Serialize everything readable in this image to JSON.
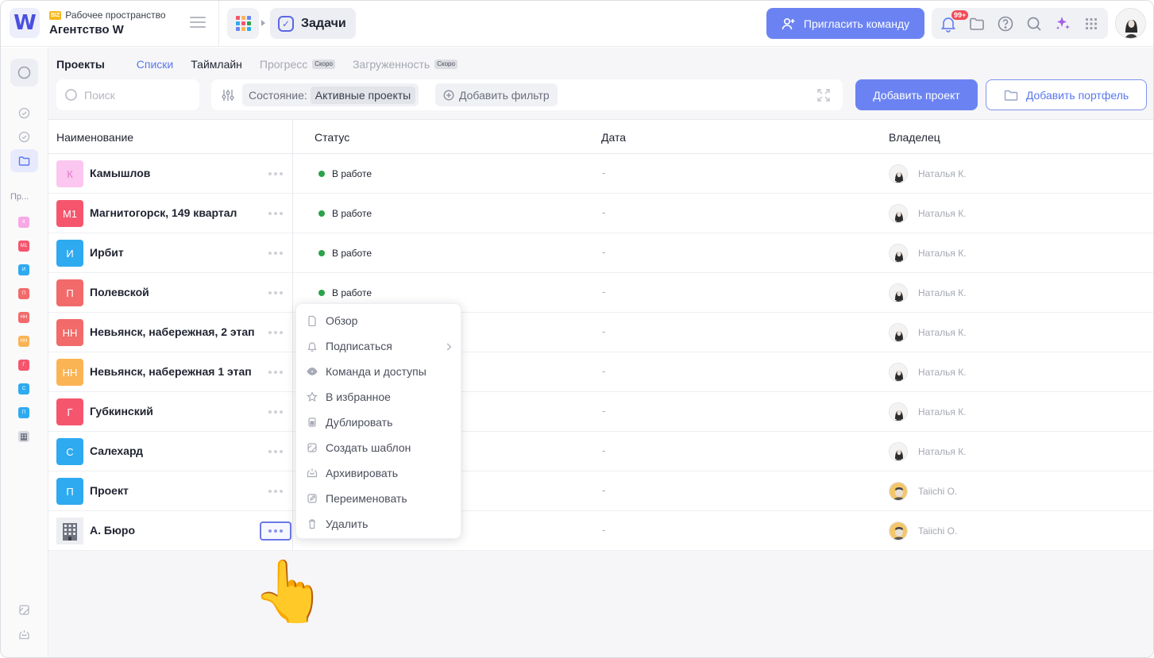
{
  "app": {
    "logo_letter": "W",
    "workspace_badge": "BIZ",
    "workspace_label": "Рабочее пространство",
    "workspace_name": "Агентство W",
    "section": "Задачи",
    "invite_label": "Пригласить команду",
    "notifications_count": "99+",
    "brand_color": "#6b83f2",
    "accent_color": "#5a78ee"
  },
  "rail": {
    "label": "Пр...",
    "chips": [
      {
        "text": "К",
        "color": "#f7a8e5"
      },
      {
        "text": "М1",
        "color": "#f5566e"
      },
      {
        "text": "И",
        "color": "#2eaaf0"
      },
      {
        "text": "П",
        "color": "#f26a6a"
      },
      {
        "text": "НН",
        "color": "#f26a6a"
      },
      {
        "text": "НН",
        "color": "#fbb454"
      },
      {
        "text": "Г",
        "color": "#f5566e"
      },
      {
        "text": "С",
        "color": "#2eaaf0"
      },
      {
        "text": "П",
        "color": "#2eaaf0"
      }
    ]
  },
  "tabs": {
    "title": "Проекты",
    "lists": "Списки",
    "timeline": "Таймлайн",
    "progress": "Прогресс",
    "workload": "Загруженность",
    "soon": "Скоро"
  },
  "toolbar": {
    "search_placeholder": "Поиск",
    "state_label": "Состояние:",
    "state_value": "Активные проекты",
    "add_filter": "Добавить фильтр",
    "add_project": "Добавить проект",
    "add_portfolio": "Добавить портфель"
  },
  "table": {
    "headers": {
      "name": "Наименование",
      "status": "Статус",
      "date": "Дата",
      "owner": "Владелец"
    },
    "rows": [
      {
        "chip": "К",
        "chip_color": "#fbc6ef",
        "chip_text_color": "#e07ccc",
        "name": "Камышлов",
        "status": "В работе",
        "date": "-",
        "owner": "Наталья К.",
        "avatar": "woman"
      },
      {
        "chip": "М1",
        "chip_color": "#f5566e",
        "chip_text_color": "#ffffff",
        "name": "Магнитогорск, 149 квартал",
        "status": "В работе",
        "date": "-",
        "owner": "Наталья К.",
        "avatar": "woman"
      },
      {
        "chip": "И",
        "chip_color": "#2eaaf0",
        "chip_text_color": "#ffffff",
        "name": "Ирбит",
        "status": "В работе",
        "date": "-",
        "owner": "Наталья К.",
        "avatar": "woman"
      },
      {
        "chip": "П",
        "chip_color": "#f26a6a",
        "chip_text_color": "#ffffff",
        "name": "Полевской",
        "status": "В работе",
        "date": "-",
        "owner": "Наталья К.",
        "avatar": "woman"
      },
      {
        "chip": "НН",
        "chip_color": "#f26a6a",
        "chip_text_color": "#ffffff",
        "name": "Невьянск, набережная, 2 этап",
        "status": "",
        "date": "-",
        "owner": "Наталья К.",
        "avatar": "woman"
      },
      {
        "chip": "НН",
        "chip_color": "#fbb454",
        "chip_text_color": "#ffffff",
        "name": "Невьянск, набережная 1 этап",
        "status": "",
        "date": "-",
        "owner": "Наталья К.",
        "avatar": "woman"
      },
      {
        "chip": "Г",
        "chip_color": "#f5566e",
        "chip_text_color": "#ffffff",
        "name": "Губкинский",
        "status": "",
        "date": "-",
        "owner": "Наталья К.",
        "avatar": "woman"
      },
      {
        "chip": "С",
        "chip_color": "#2eaaf0",
        "chip_text_color": "#ffffff",
        "name": "Салехард",
        "status": "",
        "date": "-",
        "owner": "Наталья К.",
        "avatar": "woman"
      },
      {
        "chip": "П",
        "chip_color": "#2eaaf0",
        "chip_text_color": "#ffffff",
        "name": "Проект",
        "status": "",
        "date": "-",
        "owner": "Taiichi O.",
        "avatar": "man"
      },
      {
        "chip": "",
        "chip_color": "#eceef2",
        "chip_text_color": "#ffffff",
        "name": "А. Бюро",
        "status": "",
        "date": "-",
        "owner": "Taiichi O.",
        "avatar": "man",
        "image": "building-icon"
      }
    ]
  },
  "context_menu": {
    "items": [
      {
        "label": "Обзор",
        "icon": "document-icon"
      },
      {
        "label": "Подписаться",
        "icon": "bell-icon",
        "submenu": true
      },
      {
        "label": "Команда и доступы",
        "icon": "eye-icon"
      },
      {
        "label": "В избранное",
        "icon": "star-icon"
      },
      {
        "label": "Дублировать",
        "icon": "duplicate-icon"
      },
      {
        "label": "Создать шаблон",
        "icon": "template-icon"
      },
      {
        "label": "Архивировать",
        "icon": "archive-icon"
      },
      {
        "label": "Переименовать",
        "icon": "edit-icon"
      },
      {
        "label": "Удалить",
        "icon": "trash-icon"
      }
    ]
  }
}
